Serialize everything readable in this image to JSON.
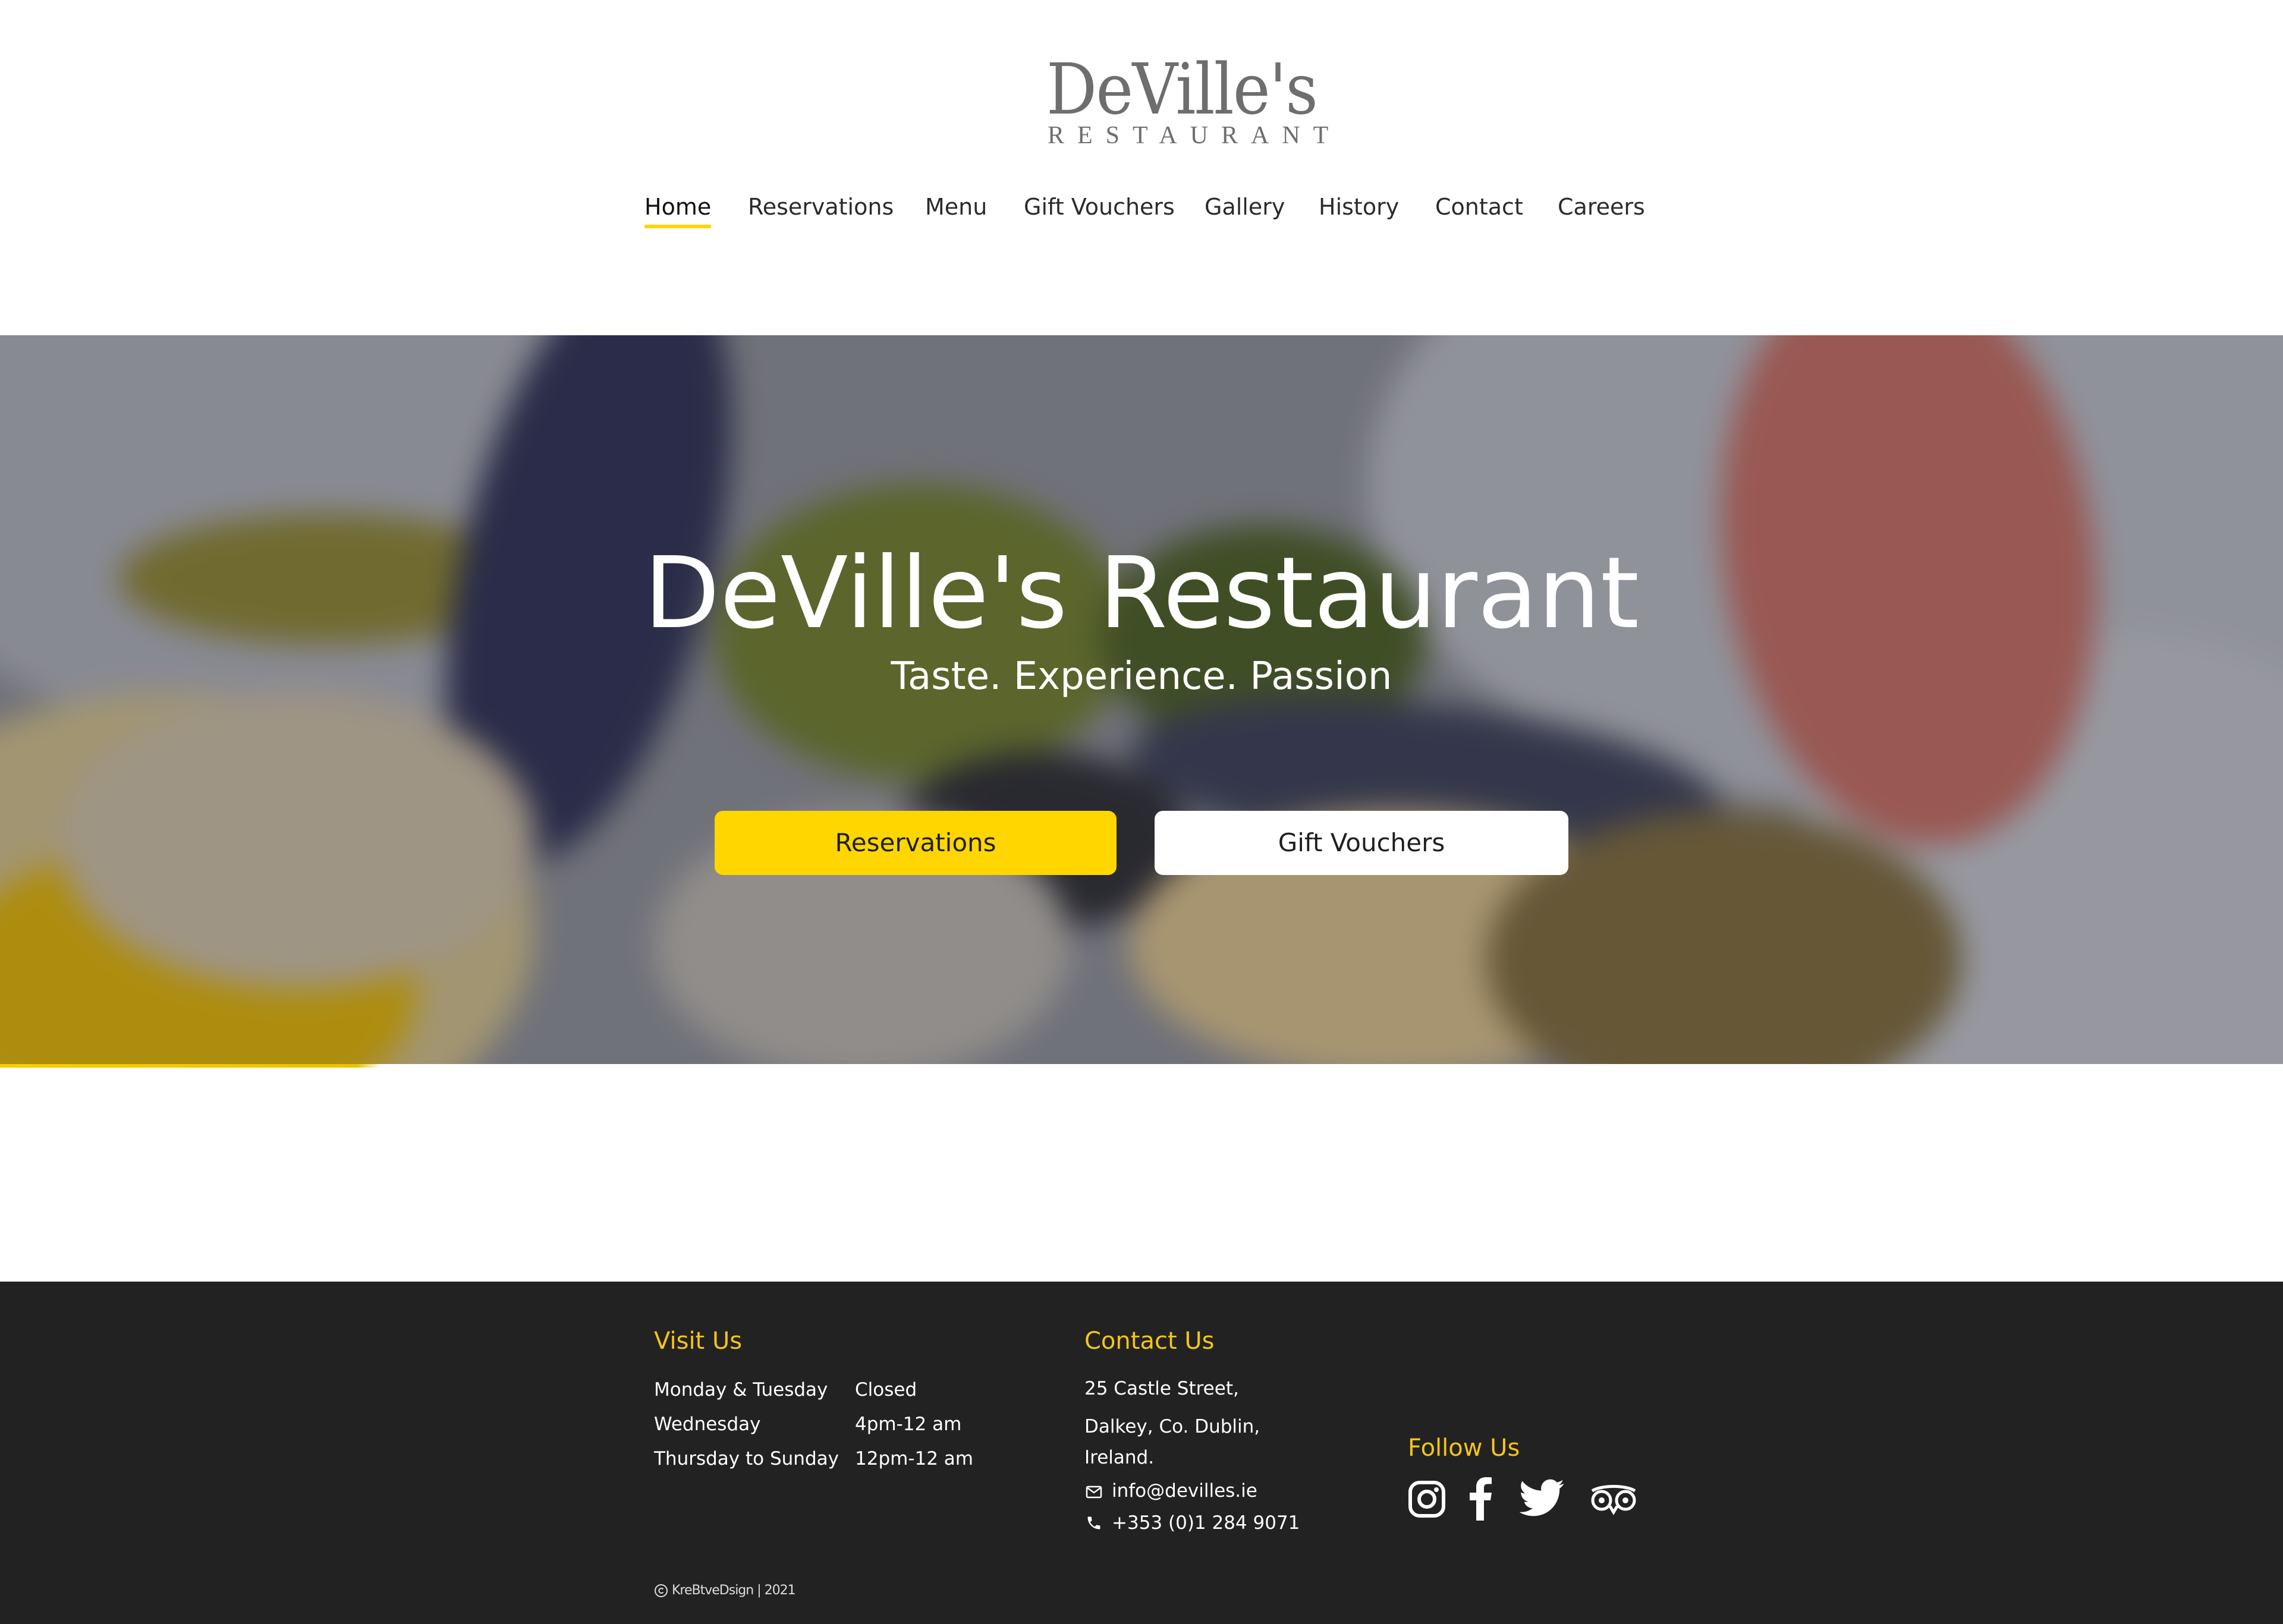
{
  "brand": {
    "logo_name": "DeVille's",
    "logo_sub": "RESTAURANT"
  },
  "nav": {
    "items": [
      {
        "label": "Home",
        "active": true
      },
      {
        "label": "Reservations",
        "active": false
      },
      {
        "label": "Menu",
        "active": false
      },
      {
        "label": "Gift Vouchers",
        "active": false
      },
      {
        "label": "Gallery",
        "active": false
      },
      {
        "label": "History",
        "active": false
      },
      {
        "label": "Contact",
        "active": false
      },
      {
        "label": "Careers",
        "active": false
      }
    ]
  },
  "hero": {
    "title": "DeVille's Restaurant",
    "tagline": "Taste. Experience. Passion",
    "primary_button": "Reservations",
    "secondary_button": "Gift Vouchers"
  },
  "footer": {
    "visit": {
      "heading": "Visit Us",
      "hours": [
        {
          "days": "Monday & Tuesday",
          "time": "Closed"
        },
        {
          "days": "Wednesday",
          "time": "4pm-12 am"
        },
        {
          "days": "Thursday to Sunday",
          "time": "12pm-12 am"
        }
      ]
    },
    "contact": {
      "heading": "Contact Us",
      "address": [
        "25 Castle Street,",
        "Dalkey, Co. Dublin,",
        "Ireland."
      ],
      "email": "info@devilles.ie",
      "phone": "+353 (0)1 284 9071"
    },
    "follow": {
      "heading": "Follow Us",
      "icons": [
        "instagram-icon",
        "facebook-icon",
        "twitter-icon",
        "tripadvisor-icon"
      ]
    },
    "copyright": "KreBtveDsign | 2021"
  },
  "colors": {
    "accent": "#ffd600",
    "footer_bg": "#222222",
    "footer_heading": "#f5c518"
  }
}
